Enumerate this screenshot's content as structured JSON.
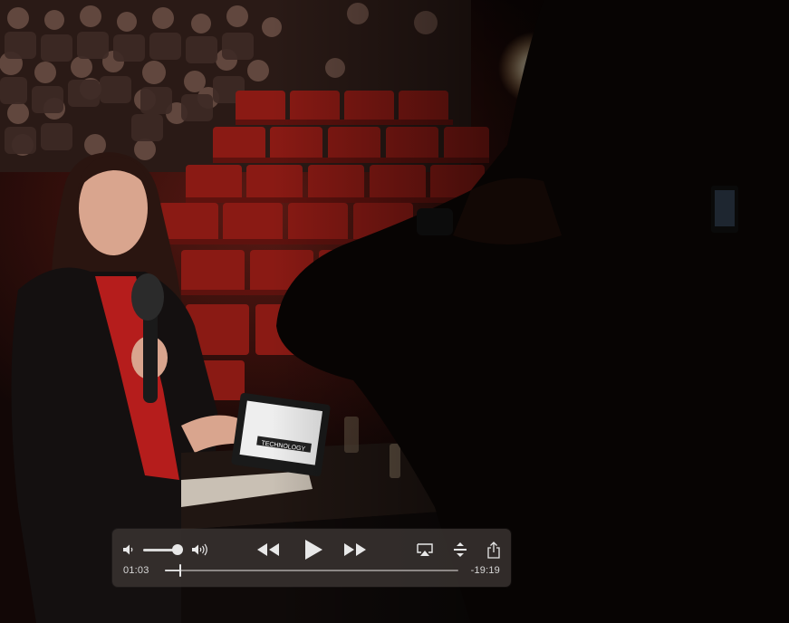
{
  "player": {
    "elapsed_time": "01:03",
    "remaining_time": "-19:19",
    "progress_fraction": 0.054,
    "volume_fraction": 0.9
  },
  "video": {
    "laptop_screen_text": "TECHNOLOGY"
  },
  "icons": {
    "volume_min": "speaker-low-icon",
    "volume_max": "speaker-high-icon",
    "rewind": "rewind-icon",
    "play": "play-icon",
    "forward": "fast-forward-icon",
    "airplay": "airplay-icon",
    "resize": "resize-icon",
    "share": "share-icon"
  },
  "colors": {
    "seat_red": "#8a1a14",
    "control_bg": "#3a3432",
    "control_fg": "#e8e8e8"
  }
}
